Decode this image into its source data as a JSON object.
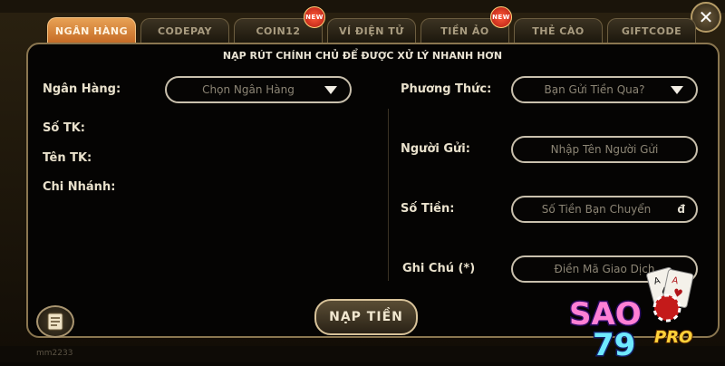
{
  "tabs": [
    {
      "label": "NGÂN HÀNG",
      "active": true,
      "new": false
    },
    {
      "label": "CODEPAY",
      "active": false,
      "new": false
    },
    {
      "label": "COIN12",
      "active": false,
      "new": true
    },
    {
      "label": "VÍ ĐIỆN TỬ",
      "active": false,
      "new": false
    },
    {
      "label": "TIỀN ẢO",
      "active": false,
      "new": true
    },
    {
      "label": "THẺ CÀO",
      "active": false,
      "new": false
    },
    {
      "label": "GIFTCODE",
      "active": false,
      "new": false
    }
  ],
  "badge_text": "NEW",
  "close_symbol": "✕",
  "notice": "NẠP RÚT CHÍNH CHỦ ĐỂ ĐƯỢC XỬ LÝ NHANH HƠN",
  "left": {
    "bank_label": "Ngân Hàng:",
    "bank_select": "Chọn Ngân Hàng",
    "account_number_label": "Số TK:",
    "account_name_label": "Tên TK:",
    "branch_label": "Chi Nhánh:"
  },
  "right": {
    "method_label": "Phương Thức:",
    "method_select": "Bạn Gửi Tiền Qua?",
    "sender_label": "Người Gửi:",
    "sender_placeholder": "Nhập Tên Người Gửi",
    "amount_label": "Số Tiền:",
    "amount_placeholder": "Số Tiền Bạn Chuyển",
    "currency": "đ",
    "note_label": "Ghi Chú (*)",
    "note_placeholder": "Điền Mã Giao Dịch"
  },
  "submit_label": "NẠP TIỀN",
  "footer_user": "mm2233",
  "logo": {
    "name": "SAO",
    "number": "79",
    "suffix": "PRO"
  },
  "colors": {
    "accent": "#d27a30",
    "border": "#8a7650",
    "text": "#e9e1cc"
  }
}
